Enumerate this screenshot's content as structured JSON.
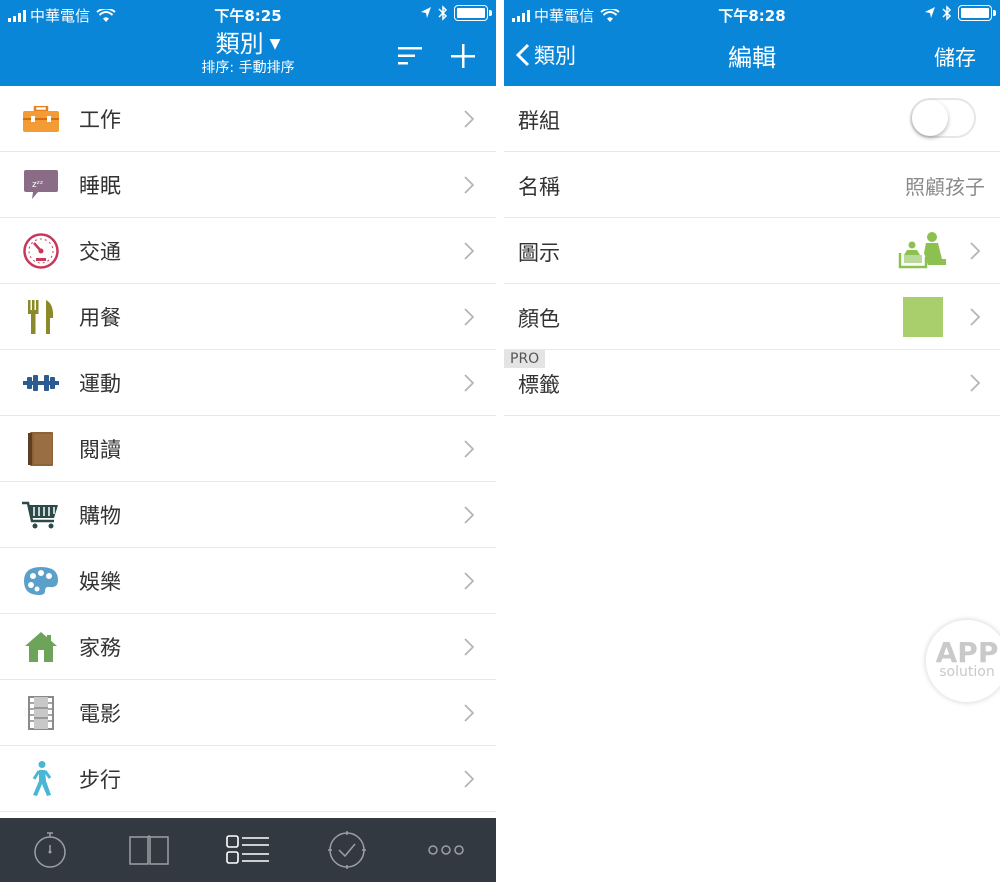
{
  "status_left": {
    "carrier": "中華電信",
    "time": "下午8:25"
  },
  "status_right": {
    "carrier": "中華電信",
    "time": "下午8:28"
  },
  "left_header": {
    "title": "類別",
    "subtitle": "排序: 手動排序"
  },
  "categories": [
    {
      "label": "工作",
      "icon": "toolbox-icon"
    },
    {
      "label": "睡眠",
      "icon": "sleep-bubble-icon"
    },
    {
      "label": "交通",
      "icon": "speedometer-icon"
    },
    {
      "label": "用餐",
      "icon": "fork-knife-icon"
    },
    {
      "label": "運動",
      "icon": "dumbbell-icon"
    },
    {
      "label": "閱讀",
      "icon": "book-icon"
    },
    {
      "label": "購物",
      "icon": "cart-icon"
    },
    {
      "label": "娛樂",
      "icon": "palette-icon"
    },
    {
      "label": "家務",
      "icon": "house-icon"
    },
    {
      "label": "電影",
      "icon": "film-icon"
    },
    {
      "label": "步行",
      "icon": "walker-icon"
    }
  ],
  "tabs": [
    "stopwatch-icon",
    "book-icon",
    "list-icon",
    "check-circle-icon",
    "more-icon"
  ],
  "edit_header": {
    "back": "類別",
    "title": "編輯",
    "save": "儲存"
  },
  "edit_rows": {
    "group": {
      "label": "群組",
      "toggle": false
    },
    "name": {
      "label": "名稱",
      "value": "照顧孩子"
    },
    "icon": {
      "label": "圖示",
      "icon": "childcare-icon"
    },
    "color": {
      "label": "顏色",
      "value": "#a8cf6b"
    },
    "tags": {
      "label": "標籤",
      "badge": "PRO"
    }
  },
  "watermark": {
    "line1": "APP",
    "line2": "solution"
  },
  "colors": {
    "header": "#0a86d8",
    "tabbar": "#333940"
  }
}
